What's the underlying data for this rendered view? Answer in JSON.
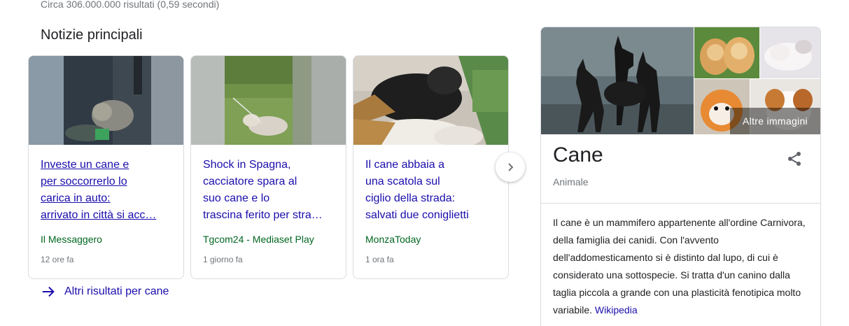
{
  "results_stats": "Circa 306.000.000 risultati (0,59 secondi)",
  "top_stories": {
    "title": "Notizie principali",
    "cards": [
      {
        "headline_lines": [
          "Investe un cane e",
          "per soccorrerlo lo",
          "carica in auto:",
          "arrivato in città si acc…"
        ],
        "source": "Il Messaggero",
        "time": "12 ore fa"
      },
      {
        "headline_lines": [
          "Shock in Spagna,",
          "cacciatore spara al",
          "suo cane e lo",
          "trascina ferito per stra…"
        ],
        "source": "Tgcom24 - Mediaset Play",
        "time": "1 giorno fa"
      },
      {
        "headline_lines": [
          "Il cane abbaia a",
          "una scatola sul",
          "ciglio della strada:",
          "salvati due coniglietti"
        ],
        "source": "MonzaToday",
        "time": "1 ora fa"
      }
    ],
    "more_results": "Altri risultati per cane"
  },
  "knowledge_panel": {
    "more_images": "Altre immagini",
    "title": "Cane",
    "subtitle": "Animale",
    "description": "Il cane è un mammifero appartenente all'ordine Carnivora, della famiglia dei canidi. Con l'avvento dell'addomesticamento si è distinto dal lupo, di cui è considerato una sottospecie. Si tratta d'un canino dalla taglia piccola a grande con una plasticità fenotipica molto variabile.",
    "source_link": "Wikipedia"
  },
  "colors": {
    "link": "#1a0dab",
    "source": "#006621",
    "meta": "#70757a",
    "border": "#dadce0"
  },
  "icons": {
    "next": "chevron-right-icon",
    "more_arrow": "arrow-right-icon",
    "share": "share-icon"
  }
}
